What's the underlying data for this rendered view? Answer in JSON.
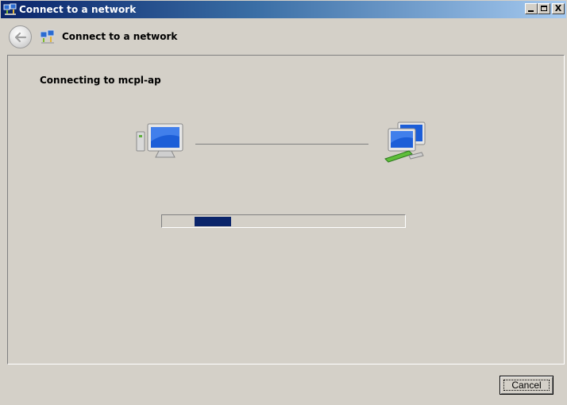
{
  "window": {
    "title": "Connect to a network",
    "controls": {
      "minimize_icon": "minimize-icon",
      "maximize_icon": "maximize-icon",
      "close_symbol": "X"
    }
  },
  "nav": {
    "back_icon": "back-arrow-icon",
    "title": "Connect to a network",
    "icon": "network-icon"
  },
  "content": {
    "status_text": "Connecting to mcpl-ap",
    "left_icon": "computer-icon",
    "right_icon": "network-computers-icon",
    "progress": {
      "chunk_start_fraction": 0.13,
      "chunk_width_fraction": 0.15
    }
  },
  "footer": {
    "cancel_label": "Cancel"
  },
  "colors": {
    "titlebar_start": "#0a246a",
    "titlebar_end": "#a6caf0",
    "progress_fill": "#0a246a",
    "surface": "#d4d0c8"
  }
}
